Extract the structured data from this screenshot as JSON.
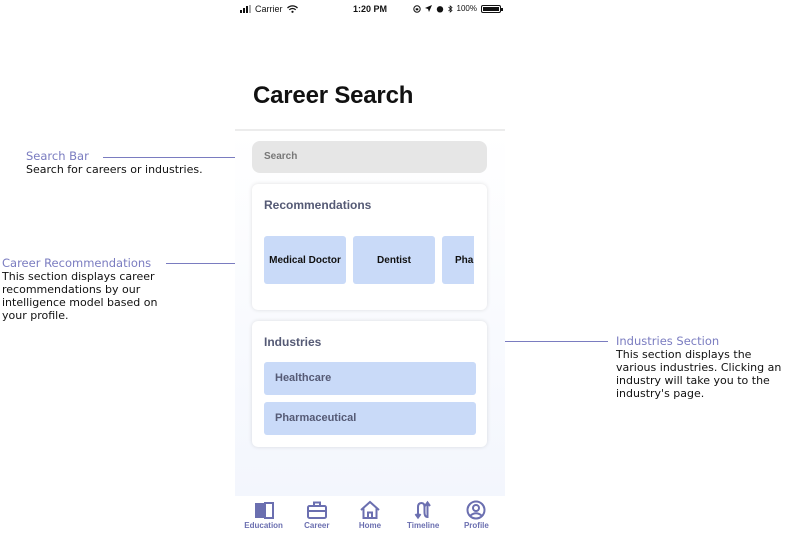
{
  "status_bar": {
    "carrier": "Carrier",
    "time": "1:20 PM",
    "battery": "100%"
  },
  "page_title": "Career Search",
  "search": {
    "placeholder": "Search"
  },
  "recommendations": {
    "title": "Recommendations",
    "items": [
      "Medical Doctor",
      "Dentist",
      "Pharmacist"
    ]
  },
  "industries": {
    "title": "Industries",
    "items": [
      "Healthcare",
      "Pharmaceutical"
    ]
  },
  "tab_bar": {
    "items": [
      {
        "label": "Education",
        "icon": "book-icon"
      },
      {
        "label": "Career",
        "icon": "briefcase-icon"
      },
      {
        "label": "Home",
        "icon": "home-icon"
      },
      {
        "label": "Timeline",
        "icon": "timeline-arrows-icon"
      },
      {
        "label": "Profile",
        "icon": "profile-icon"
      }
    ]
  },
  "annotations": {
    "search_bar": {
      "title": "Search Bar",
      "lines": [
        "Search for careers or industries."
      ]
    },
    "career_recommendations": {
      "title": "Career Recommendations",
      "lines": [
        "This section displays career",
        "recommendations by our",
        "intelligence model based on",
        "your profile."
      ]
    },
    "industries_section": {
      "title": "Industries Section",
      "lines": [
        "This section displays the",
        "various industries. Clicking an",
        "industry will take you to the",
        "industry's page."
      ]
    }
  },
  "colors": {
    "accent": "#6b6fb0",
    "tile": "#c9daf8",
    "annotation_heading": "#7a7cc0"
  }
}
